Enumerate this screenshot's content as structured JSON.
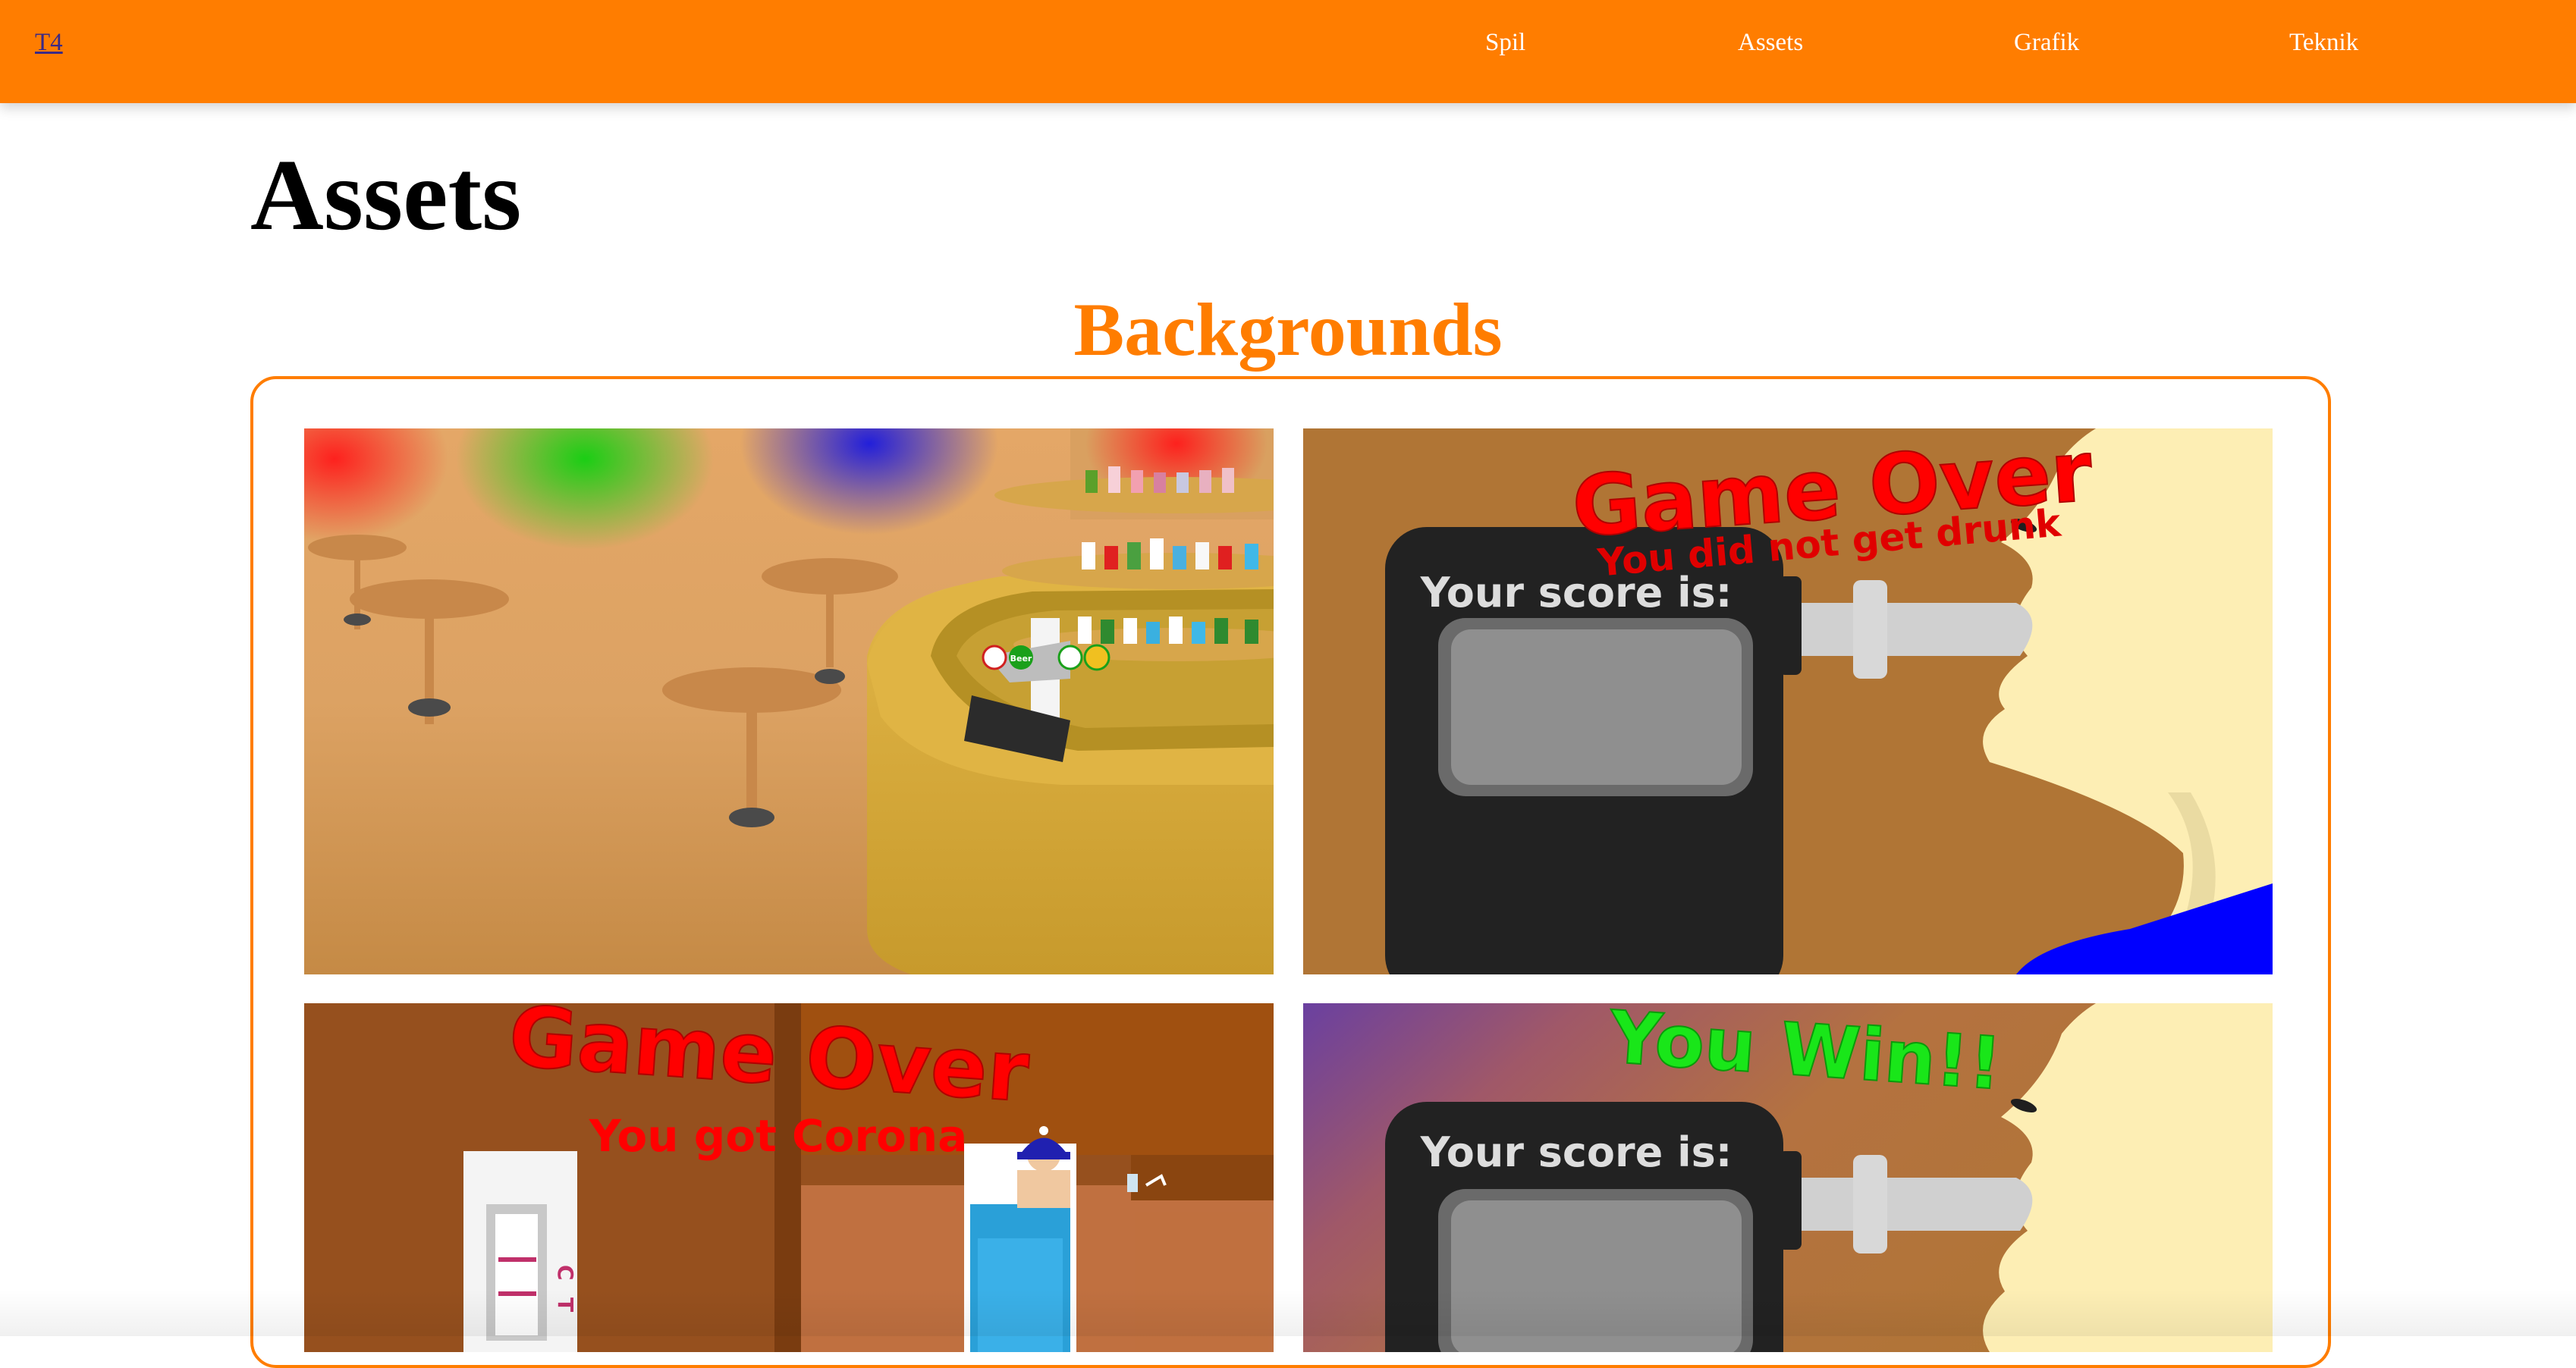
{
  "nav": {
    "brand": "T4",
    "links": [
      "Spil",
      "Assets",
      "Grafik",
      "Teknik"
    ]
  },
  "page_title": "Assets",
  "section": {
    "heading": "Backgrounds"
  },
  "tiles": {
    "bar": {
      "beer_label": "Beer"
    },
    "drunk_over": {
      "headline": "Game Over",
      "subline": "You did not get drunk",
      "score_label": "Your score is:"
    },
    "corona_over": {
      "headline": "Game Over",
      "subline": "You got Corona",
      "test_marks": [
        "C",
        "T"
      ]
    },
    "win": {
      "headline": "You Win!!",
      "score_label": "Your score is:"
    }
  },
  "colors": {
    "accent": "#ff7d00",
    "brand_link": "#3b2a86",
    "game_over_red": "#ff0000",
    "win_green": "#19e619"
  }
}
